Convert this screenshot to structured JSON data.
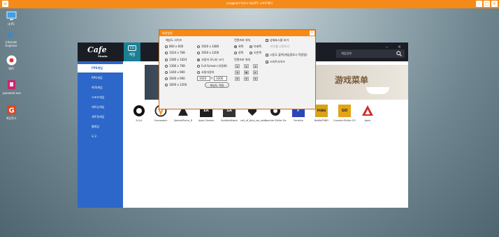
{
  "vm": {
    "title": "pinggood 이지크 대상/PC 소프트웨어"
  },
  "desktop": {
    "icons": [
      "내 PC",
      "Internet Explorer",
      "Wifi",
      "panaeod.exe",
      "게임전시"
    ]
  },
  "app": {
    "logo": "Cafe",
    "logo_sub": "Maxin",
    "top_tab": "게임",
    "search_placeholder": "게임검색",
    "sidebar": [
      "FPS게임",
      "RPG게임",
      "AOS게임",
      "스포츠게임",
      "레이싱게임",
      "캐주얼게임",
      "웹게임",
      "도구"
    ],
    "banner_text": "游戏菜单",
    "games": [
      "A.V.A",
      "Overwatch",
      "SpecialForce_R",
      "Apex Games",
      "SuddenAttack",
      "call_of_duty_wz_auto",
      "Counter-Strike Go",
      "Fortnite",
      "BattlePUBG",
      "Counter-Strike GO",
      "Apex"
    ]
  },
  "dialog": {
    "title": "화면설정",
    "resolution_label": "해상도 사이즈",
    "left_options": [
      "800 x 600",
      "1024 x 768",
      "1280 x 1024",
      "1366 x 768",
      "1440 x 900",
      "1600 x 900",
      "1600 x 1200"
    ],
    "mid_options": [
      "1920 x 1080",
      "1920 x 1200",
      "사용자 모니터 크기",
      "Full Screen (자동화)",
      "사용자정의"
    ],
    "custom_w": "1920",
    "custom_h": "1000",
    "apply": "해상도 적용",
    "content_pos_label": "컨텐츠바 위치",
    "content_pos": [
      "위쪽",
      "아래쪽",
      "왼쪽",
      "오른쪽"
    ],
    "content_size_label": "컨텐츠바 위치",
    "checks": [
      "상태표시줄 보기",
      "타이틀 고정하기",
      "시동도 출력(게임종료시 적용됨)",
      "스마트사이즈"
    ]
  }
}
